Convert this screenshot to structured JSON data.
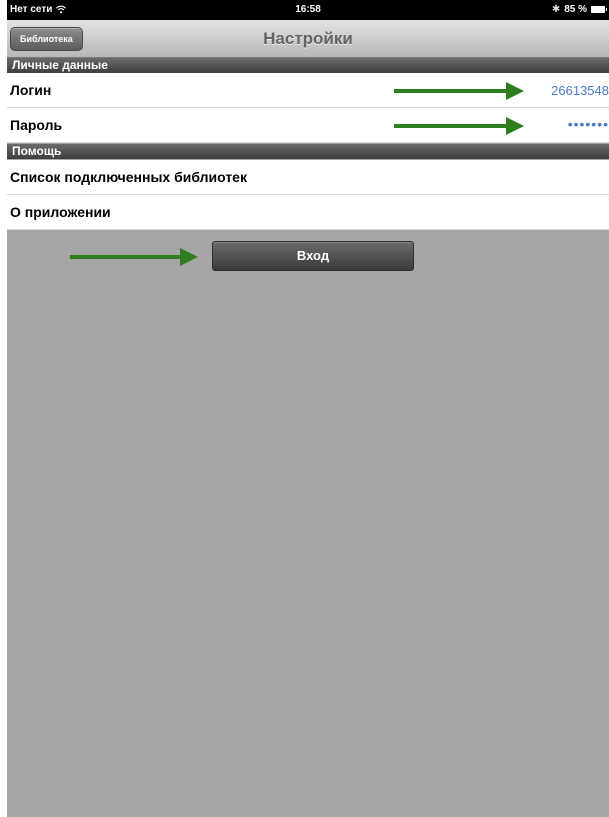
{
  "status_bar": {
    "carrier": "Нет сети",
    "time": "16:58",
    "battery": "85 %"
  },
  "nav": {
    "back_label": "Библиотека",
    "title": "Настройки"
  },
  "personal_section": {
    "header": "Личные данные",
    "login_label": "Логин",
    "login_value": "26613548",
    "password_label": "Пароль",
    "password_value": "•••••••"
  },
  "help_section": {
    "header": "Помощь",
    "libraries_label": "Список подключенных библиотек",
    "about_label": "О приложении"
  },
  "login_button_label": "Вход",
  "colors": {
    "arrow": "#2e7d1e",
    "value_text": "#4a7bc6",
    "background": "#a6a6a6"
  }
}
